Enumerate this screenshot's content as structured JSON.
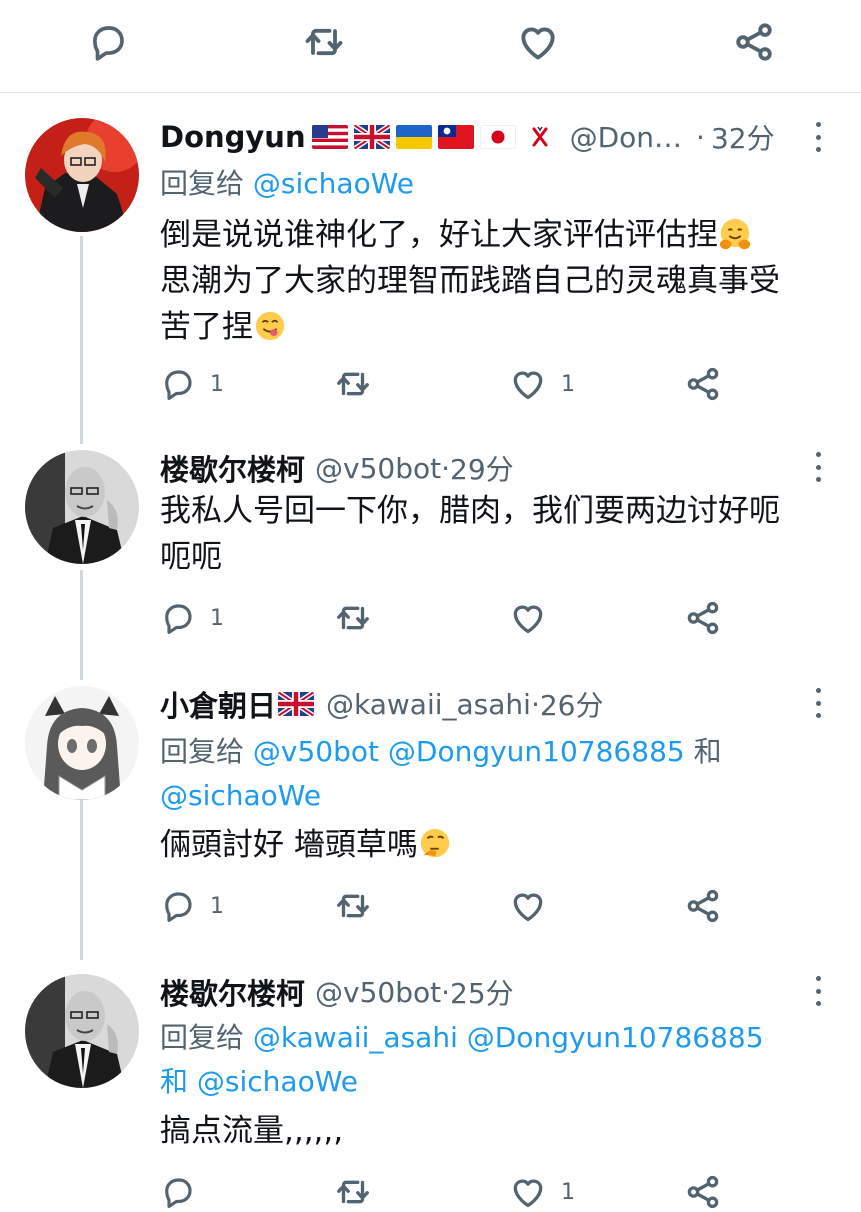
{
  "colors": {
    "link": "#1d9bf0",
    "muted": "#536471",
    "text": "#0f1419",
    "thread_line": "#cfd9de"
  },
  "top_actions": [
    "reply-icon",
    "retweet-icon",
    "like-icon",
    "share-icon"
  ],
  "tweets": [
    {
      "name": "Dongyun",
      "flags": [
        "us-flag",
        "uk-flag",
        "ukraine-flag",
        "taiwan-flag",
        "japan-flag",
        "cross-mark"
      ],
      "handle": "@Don…",
      "dot": " ·",
      "time": "32分",
      "reply_to_label": "回复给",
      "reply_to_mentions": "@sichaoWe",
      "lines": [
        "倒是说说谁神化了，好让大家评估评估捏",
        "思潮为了大家的理智而践踏自己的灵魂真事受",
        "苦了捏"
      ],
      "emojis": [
        "hugging-face-emoji",
        "yum-face-emoji"
      ],
      "reply_count": "1",
      "like_count": "1"
    },
    {
      "name": "楼歇尔楼柯",
      "handle": "@v50bot",
      "dot": " · ",
      "time": "29分",
      "lines": [
        "我私人号回一下你，腊肉，我们要两边讨好呃",
        "呃呃"
      ],
      "reply_count": "1",
      "like_count": ""
    },
    {
      "name": "小倉朝日",
      "flags": [
        "uk-flag"
      ],
      "handle": "@kawaii_asahi",
      "dot": " · ",
      "time": "26分",
      "reply_to_label": "回复给",
      "reply_to_line1": "@v50bot @Dongyun10786885",
      "reply_to_and": " 和",
      "reply_to_line2": "@sichaoWe",
      "lines": [
        "倆頭討好 墻頭草嗎"
      ],
      "emojis": [
        "thinking-face-emoji"
      ],
      "reply_count": "1",
      "like_count": ""
    },
    {
      "name": "楼歇尔楼柯",
      "handle": "@v50bot",
      "dot": " · ",
      "time": "25分",
      "reply_to_label": "回复给",
      "reply_to_line1": "@kawaii_asahi @Dongyun10786885",
      "reply_to_and": "和",
      "reply_to_line2": "@sichaoWe",
      "lines": [
        "搞点流量,,,,,,"
      ],
      "reply_count": "",
      "like_count": "1"
    }
  ]
}
